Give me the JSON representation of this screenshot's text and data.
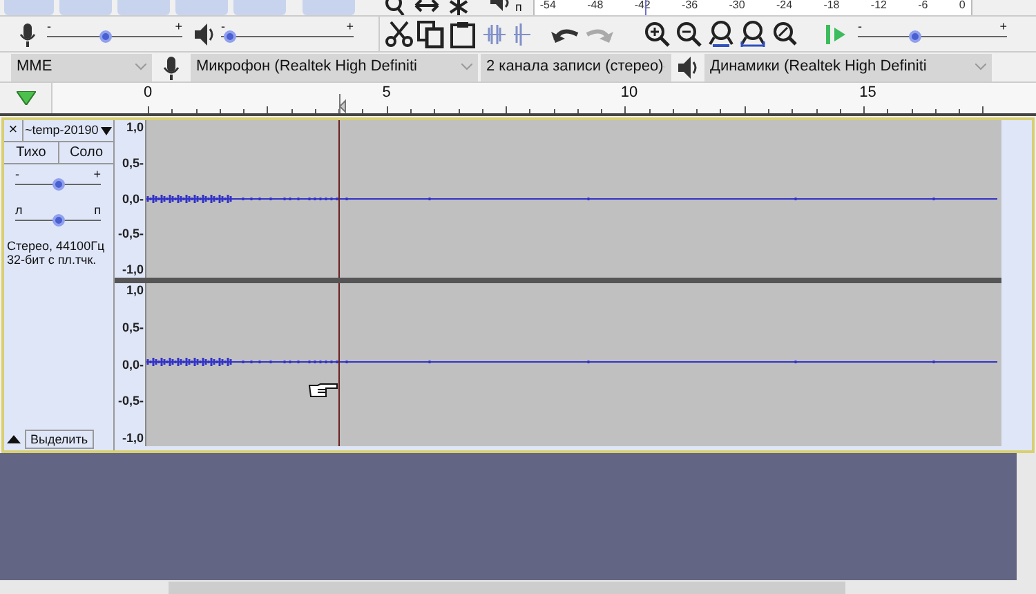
{
  "meter": {
    "channel_label": "п",
    "scale": [
      "-54",
      "-48",
      "-42",
      "-36",
      "-30",
      "-24",
      "-18",
      "-12",
      "-6",
      "0"
    ]
  },
  "mixer": {
    "recording_volume": {
      "level": 0.43
    },
    "playback_volume": {
      "level": 0.02
    },
    "minus": "-",
    "plus": "+"
  },
  "play_at_speed": {
    "level": 0.37,
    "minus": "-",
    "plus": "+"
  },
  "device_bar": {
    "host": "MME",
    "recording_device": "Микрофон (Realtek High Definiti",
    "recording_channels": "2 канала записи (стерео)",
    "playback_device": "Динамики (Realtek High Definiti"
  },
  "timeline": {
    "labels": [
      "0",
      "5",
      "10",
      "15"
    ]
  },
  "track": {
    "close": "×",
    "name": "~temp-20190",
    "mute": "Тихо",
    "solo": "Соло",
    "gain": {
      "minus": "-",
      "plus": "+",
      "level": 0.5
    },
    "pan": {
      "left": "л",
      "right": "п",
      "level": 0.5
    },
    "info": [
      "Стерео, 44100Гц",
      "32-бит с пл.тчк."
    ],
    "select": "Выделить",
    "channels": [
      {
        "scale": [
          "1,0",
          "0,5-",
          "0,0-",
          "-0,5-",
          "-1,0"
        ]
      },
      {
        "scale": [
          "1,0",
          "0,5-",
          "0,0-",
          "-0,5-",
          "-1,0"
        ]
      }
    ]
  }
}
